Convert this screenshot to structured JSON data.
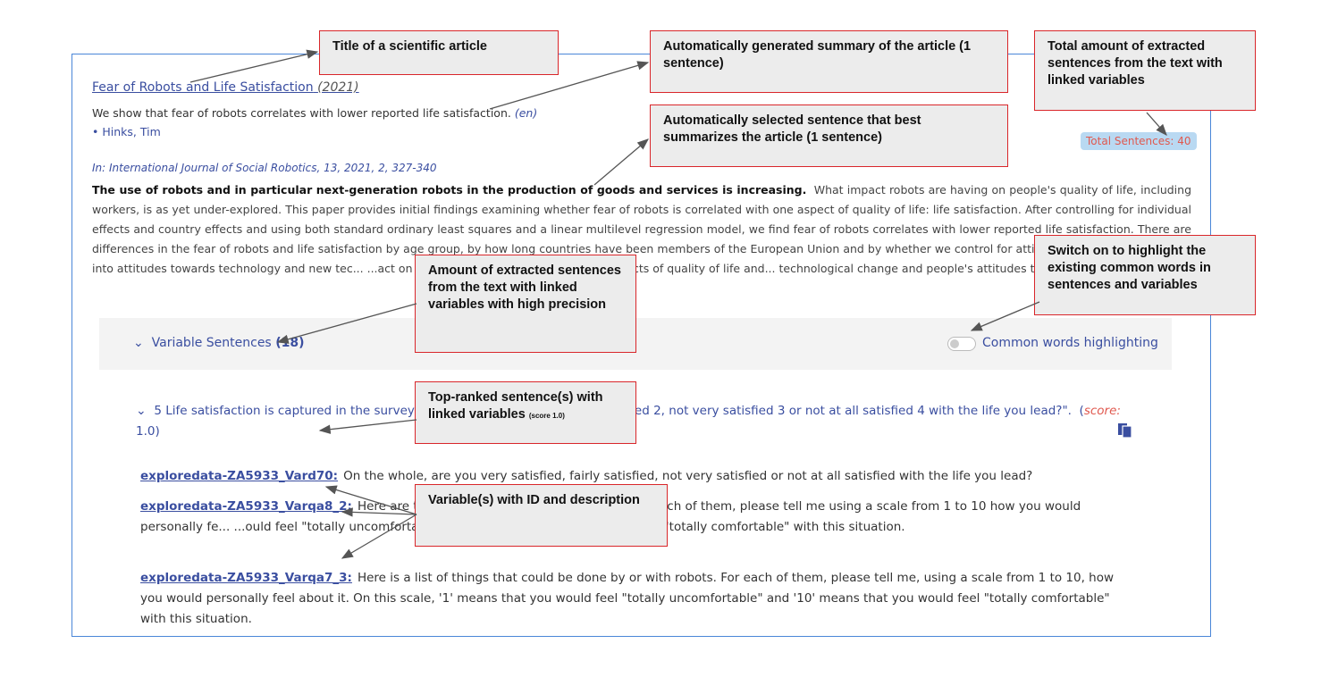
{
  "article": {
    "title": "Fear of Robots and Life Satisfaction",
    "year": "(2021)",
    "summary": "We show that fear of robots correlates with lower reported life satisfaction.",
    "lang": "(en)",
    "author": "• Hinks, Tim",
    "journal": "In: International Journal of Social Robotics, 13, 2021, 2, 327-340",
    "abstract_bold": "The use of robots and in particular next-generation robots in the production of goods and services is increasing.",
    "abstract_rest": "What impact robots are having on people's quality of life, including workers, is as yet under-explored. This paper provides initial findings examining whether fear of robots is correlated with one aspect of quality of life: life satisfaction. After controlling for individual effects and country effects and using both standard ordinary least squares and a linear multilevel regression model, we find fear of robots correlates with lower reported life satisfaction. There are differences in the fear of robots and life satisfaction by age group, by how long countries have been members of the European Union and by whether we control for attitudes towards ot... research into attitudes towards technology and new tec... ...act on current life satisfaction and other aspects of quality of life and... technological change and people's attitudes towards these...",
    "total_sentences": "Total Sentences: 40"
  },
  "variable_section": {
    "label": "Variable Sentences",
    "count": "(18)",
    "toggle_label": "Common words highlighting",
    "toggle_on": false
  },
  "sentence": {
    "text": "5 Life satisfaction is captured in the survey ... ...ou very satisfied 1, fairly satisfied 2, not very satisfied 3 or not at all satisfied 4 with the life you lead?\".",
    "score_label": "score:",
    "score_value": "1.0"
  },
  "variables": [
    {
      "id": "exploredata-ZA5933_Vard70:",
      "text": "On the whole, are you very satisfied, fairly satisfied, not very satisfied or not at all satisfied with the life you lead?"
    },
    {
      "id": "exploredata-ZA5933_Varqa8_2:",
      "text": "Here are tw... ...verless cars on public roads. For each of them, please tell me using a scale from 1 to 10 how you would personally fe... ...ould feel \"totally uncomfortable\" and '10' means that you would feel \"totally comfortable\" with this situation."
    },
    {
      "id": "exploredata-ZA5933_Varqa7_3:",
      "text": "Here is a list of things that could be done by or with robots. For each of them, please tell me, using a scale from 1 to 10, how you would personally feel about it. On this scale, '1' means that you would feel \"totally uncomfortable\" and '10' means that you would feel \"totally comfortable\" with this situation."
    }
  ],
  "callouts": {
    "title": "Title of a scientific article",
    "summary": "Automatically generated summary of the article (1 sentence)",
    "total": "Total amount of extracted sentences from the text with linked variables",
    "best": "Automatically selected sentence that best summarizes the article (1 sentence)",
    "switch": "Switch on to highlight the existing common words in sentences and variables",
    "amount": "Amount of extracted sentences from the text with linked variables with high precision",
    "top_main": "Top-ranked sentence(s) with linked variables",
    "top_small": "(score 1.0)",
    "variables": "Variable(s) with ID and description"
  },
  "colors": {
    "link": "#3a4ea0",
    "callout_border": "#d9262a",
    "frame": "#4a86d8",
    "score": "#e0594f"
  }
}
